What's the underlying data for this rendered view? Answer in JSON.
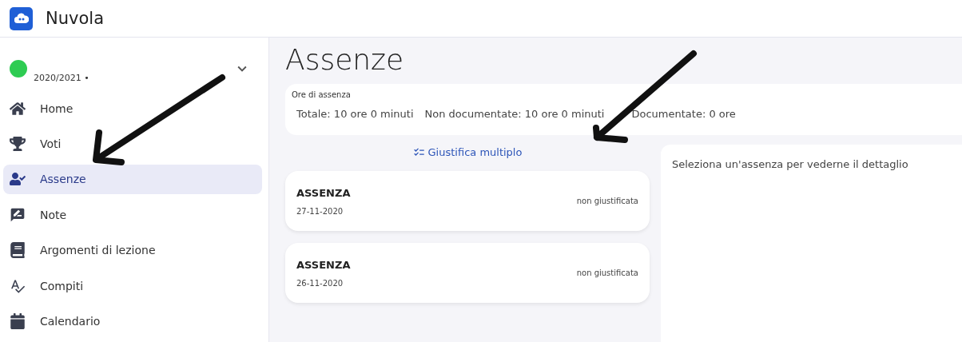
{
  "app": {
    "title": "Nuvola"
  },
  "year": {
    "label": "2020/2021 •"
  },
  "sidebar": {
    "items": [
      {
        "kind": "home",
        "label": "Home",
        "selected": false
      },
      {
        "kind": "trophy",
        "label": "Voti",
        "selected": false
      },
      {
        "kind": "user-check",
        "label": "Assenze",
        "selected": true
      },
      {
        "kind": "note",
        "label": "Note",
        "selected": false
      },
      {
        "kind": "book",
        "label": "Argomenti di lezione",
        "selected": false
      },
      {
        "kind": "spell",
        "label": "Compiti",
        "selected": false
      },
      {
        "kind": "calendar",
        "label": "Calendario",
        "selected": false
      }
    ]
  },
  "page": {
    "title": "Assenze"
  },
  "summary": {
    "title": "Ore di assenza",
    "stats": [
      "Totale: 10 ore 0 minuti",
      "Non documentate: 10 ore 0 minuti",
      "Documentate: 0 ore"
    ]
  },
  "action": {
    "label": "Giustifica multiplo"
  },
  "absences": [
    {
      "type": "ASSENZA",
      "date": "27-11-2020",
      "status": "non giustificata"
    },
    {
      "type": "ASSENZA",
      "date": "26-11-2020",
      "status": "non giustificata"
    }
  ],
  "detail": {
    "message": "Seleziona un'assenza per vederne il dettaglio"
  }
}
